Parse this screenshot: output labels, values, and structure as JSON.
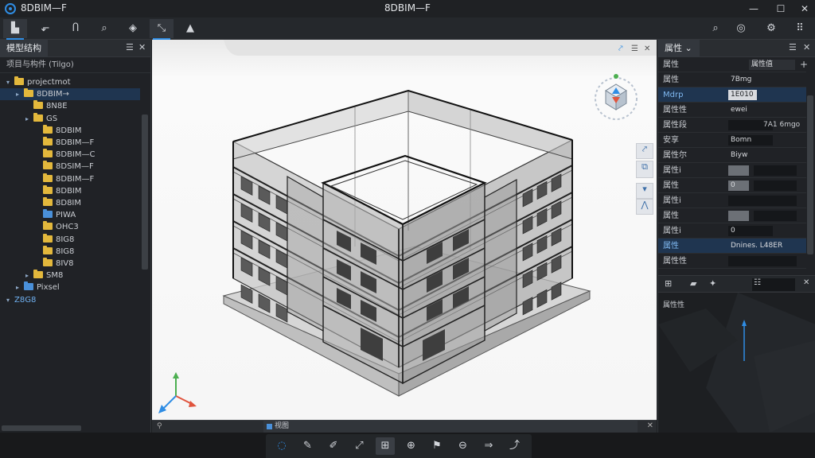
{
  "app": {
    "title_left": "8DBIM—F",
    "window_title": "8DBIM—F",
    "accent": "#2f8de4"
  },
  "window_controls": {
    "minimize": "—",
    "maximize": "☐",
    "close": "✕"
  },
  "toolbar": {
    "items": [
      {
        "icon": "file-icon",
        "glyph": "▙",
        "active": true
      },
      {
        "icon": "import-icon",
        "glyph": "⬐",
        "active": false
      },
      {
        "icon": "model-icon",
        "glyph": "Ⴖ",
        "active": false
      },
      {
        "icon": "search-icon",
        "glyph": "⌕",
        "active": false
      },
      {
        "icon": "layers-icon",
        "glyph": "◈",
        "active": false
      },
      {
        "icon": "measure-icon",
        "glyph": "⤡",
        "active": true
      },
      {
        "icon": "render-icon",
        "glyph": "▲",
        "active": false
      }
    ],
    "right_items": [
      {
        "icon": "zoom-icon",
        "glyph": "⌕"
      },
      {
        "icon": "globe-icon",
        "glyph": "◎"
      },
      {
        "icon": "gear-icon",
        "glyph": "⚙"
      },
      {
        "icon": "grid-icon",
        "glyph": "⠿"
      }
    ]
  },
  "left_panel": {
    "tab_label": "模型结构",
    "subheader": "项目与构件 (Tilgo)",
    "tree": [
      {
        "label": "projectmot",
        "depth": 0,
        "arrow": "▾",
        "folder": "yellow",
        "selected": false
      },
      {
        "label": "8DBIM→",
        "depth": 1,
        "arrow": "▸",
        "folder": "yellow",
        "selected": true
      },
      {
        "label": "8N8E",
        "depth": 2,
        "arrow": "",
        "folder": "yellow",
        "selected": false
      },
      {
        "label": "GS",
        "depth": 2,
        "arrow": "▸",
        "folder": "yellow",
        "selected": false
      },
      {
        "label": "8DBIM",
        "depth": 3,
        "arrow": "",
        "folder": "yellow",
        "selected": false
      },
      {
        "label": "8DBIM—F",
        "depth": 3,
        "arrow": "",
        "folder": "yellow",
        "selected": false
      },
      {
        "label": "8DBIM—C",
        "depth": 3,
        "arrow": "",
        "folder": "yellow",
        "selected": false
      },
      {
        "label": "8DSIM—F",
        "depth": 3,
        "arrow": "",
        "folder": "yellow",
        "selected": false
      },
      {
        "label": "8DBIM—F",
        "depth": 3,
        "arrow": "",
        "folder": "yellow",
        "selected": false
      },
      {
        "label": "8DBIM",
        "depth": 3,
        "arrow": "",
        "folder": "yellow",
        "selected": false
      },
      {
        "label": "8D8IM",
        "depth": 3,
        "arrow": "",
        "folder": "yellow",
        "selected": false
      },
      {
        "label": "PIWA",
        "depth": 3,
        "arrow": "",
        "folder": "blue",
        "selected": false
      },
      {
        "label": "OHC3",
        "depth": 3,
        "arrow": "",
        "folder": "yellow",
        "selected": false
      },
      {
        "label": "8IG8",
        "depth": 3,
        "arrow": "",
        "folder": "yellow",
        "selected": false
      },
      {
        "label": "8IG8",
        "depth": 3,
        "arrow": "",
        "folder": "yellow",
        "selected": false
      },
      {
        "label": "8IV8",
        "depth": 3,
        "arrow": "",
        "folder": "yellow",
        "selected": false
      },
      {
        "label": "SM8",
        "depth": 2,
        "arrow": "▸",
        "folder": "yellow",
        "selected": false
      },
      {
        "label": "Pixsel",
        "depth": 1,
        "arrow": "▸",
        "folder": "blue",
        "selected": false
      },
      {
        "label": "Z8G8",
        "depth": 0,
        "arrow": "▾",
        "folder": "none",
        "selected": false
      }
    ]
  },
  "viewport": {
    "tab_label": "视图",
    "side_buttons": [
      "⤤",
      "⧉",
      "▾",
      "⋀"
    ]
  },
  "right_panel": {
    "tab_label": "属性",
    "header_key": "属性",
    "header_value": "属性值",
    "rows": [
      {
        "key": "属性",
        "value": "7Bmg",
        "style": "plain",
        "extra": "",
        "hl": false
      },
      {
        "key": "Mdrp",
        "value": "1E010",
        "style": "box",
        "extra": "",
        "hl": true
      },
      {
        "key": "属性性",
        "value": "ewei",
        "style": "plain",
        "extra": "",
        "hl": false
      },
      {
        "key": "属性段",
        "value": "",
        "style": "box",
        "extra": "7A1 6mgo",
        "hl": false
      },
      {
        "key": "安享",
        "value": "Bomn",
        "style": "box",
        "extra": "",
        "hl": false
      },
      {
        "key": "属性尔",
        "value": "Biyw",
        "style": "plain",
        "extra": "",
        "hl": false
      },
      {
        "key": "属性i",
        "value": "",
        "style": "gray",
        "extra": "",
        "hl": false
      },
      {
        "key": "属性",
        "value": "0",
        "style": "gray",
        "extra": "",
        "hl": false
      },
      {
        "key": "属性i",
        "value": "",
        "style": "box",
        "extra": "",
        "hl": false
      },
      {
        "key": "属性",
        "value": "",
        "style": "gray",
        "extra": "",
        "hl": false
      },
      {
        "key": "属性i",
        "value": "0",
        "style": "box",
        "extra": "",
        "hl": false
      },
      {
        "key": "属性",
        "value": "Dnines. L48ER",
        "style": "plain",
        "extra": "",
        "hl": true
      },
      {
        "key": "属性性",
        "value": "",
        "style": "box",
        "extra": "",
        "hl": false
      }
    ],
    "mini_label": "属性性"
  },
  "bottom_toolbar": {
    "items": [
      {
        "icon": "orbit-icon",
        "glyph": "◌",
        "active": false
      },
      {
        "icon": "pen-icon",
        "glyph": "✎",
        "active": false
      },
      {
        "icon": "edit-icon",
        "glyph": "✐",
        "active": false
      },
      {
        "icon": "dimension-icon",
        "glyph": "⤢",
        "active": false
      },
      {
        "icon": "section-box-icon",
        "glyph": "⊞",
        "active": true
      },
      {
        "icon": "zoom-fit-icon",
        "glyph": "⊕",
        "active": false
      },
      {
        "icon": "walk-icon",
        "glyph": "⚑",
        "active": false
      },
      {
        "icon": "target-icon",
        "glyph": "⊖",
        "active": false
      },
      {
        "icon": "arrow-icon",
        "glyph": "⇒",
        "active": false
      },
      {
        "icon": "export-icon",
        "glyph": "⤴",
        "active": false
      }
    ]
  }
}
